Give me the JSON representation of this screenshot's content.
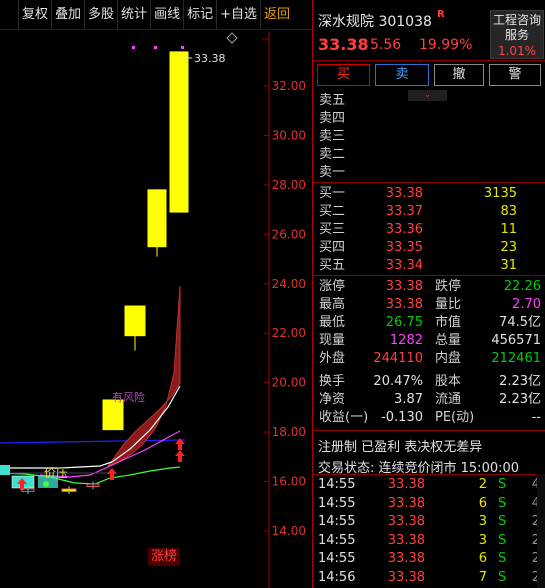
{
  "toolbar": {
    "items": [
      "复权",
      "叠加",
      "多股",
      "统计",
      "画线",
      "标记",
      "+自选",
      "返回"
    ]
  },
  "chart": {
    "annotations": {
      "high_label": "33.38",
      "risk_label": "有风险",
      "pressure_label": "价压",
      "limit_up_tag": "涨榜"
    },
    "y_ticks": [
      "32.00",
      "30.00",
      "28.00",
      "26.00",
      "24.00",
      "22.00",
      "20.00",
      "18.00",
      "16.00",
      "14.00"
    ],
    "colors": {
      "up": "#ffff00",
      "down": "#00ffff",
      "ma_white": "#ffffff",
      "ma_magenta": "#ff40ff",
      "ma_green": "#40ff40",
      "ma_blue": "#2020ff",
      "cloud": "#8b1a1a",
      "axis_text": "#e03030",
      "signal_arrow": "#ff2020"
    }
  },
  "chart_data": {
    "type": "candlestick",
    "y_axis_ticks": [
      32,
      30,
      28,
      26,
      24,
      22,
      20,
      18,
      16,
      14
    ],
    "candles": [
      {
        "open": 15.7,
        "close": 15.6,
        "high": 15.8,
        "low": 15.5
      },
      {
        "open": 15.6,
        "close": 15.7,
        "high": 15.8,
        "low": 15.5
      },
      {
        "open": 15.9,
        "close": 15.8,
        "high": 16.0,
        "low": 15.7
      },
      {
        "open": 18.1,
        "close": 19.3,
        "high": 19.3,
        "low": 18.1
      },
      {
        "open": 21.9,
        "close": 23.1,
        "high": 23.1,
        "low": 21.3
      },
      {
        "open": 25.5,
        "close": 27.8,
        "high": 27.8,
        "low": 25.1
      },
      {
        "open": 26.9,
        "close": 33.38,
        "high": 33.38,
        "low": 26.9
      }
    ]
  },
  "quote": {
    "name_code": "深水规院 301038",
    "r_badge": "R",
    "price": "33.38",
    "change": "5.56",
    "change_pct": "19.99%",
    "sector": {
      "line1": "工程咨询",
      "line2": "服务",
      "pct": "1.01%"
    },
    "buttons": {
      "buy": "买",
      "sell": "卖",
      "cancel": "撤",
      "alert": "警"
    },
    "expand_arrow": "⌄",
    "sell_levels": [
      {
        "label": "卖五"
      },
      {
        "label": "卖四"
      },
      {
        "label": "卖三"
      },
      {
        "label": "卖二"
      },
      {
        "label": "卖一"
      }
    ],
    "buy_levels": [
      {
        "label": "买一",
        "price": "33.38",
        "vol": "3135"
      },
      {
        "label": "买二",
        "price": "33.37",
        "vol": "83"
      },
      {
        "label": "买三",
        "price": "33.36",
        "vol": "11"
      },
      {
        "label": "买四",
        "price": "33.35",
        "vol": "23"
      },
      {
        "label": "买五",
        "price": "33.34",
        "vol": "31"
      }
    ],
    "stats": [
      {
        "l1": "涨停",
        "v1": "33.38",
        "c1": "#ff4040",
        "l2": "跌停",
        "v2": "22.26",
        "c2": "#00d000"
      },
      {
        "l1": "最高",
        "v1": "33.38",
        "c1": "#ff4040",
        "l2": "量比",
        "v2": "2.70",
        "c2": "#ff40ff"
      },
      {
        "l1": "最低",
        "v1": "26.75",
        "c1": "#00d000",
        "l2": "市值",
        "v2": "74.5亿",
        "c2": "#e0e0e0"
      },
      {
        "l1": "现量",
        "v1": "1282",
        "c1": "#ff40ff",
        "l2": "总量",
        "v2": "456571",
        "c2": "#e0e0e0"
      },
      {
        "l1": "外盘",
        "v1": "244110",
        "c1": "#ff4040",
        "l2": "内盘",
        "v2": "212461",
        "c2": "#00d000"
      },
      {
        "l1": "换手",
        "v1": "20.47%",
        "c1": "#e0e0e0",
        "l2": "股本",
        "v2": "2.23亿",
        "c2": "#e0e0e0"
      },
      {
        "l1": "净资",
        "v1": "3.87",
        "c1": "#e0e0e0",
        "l2": "流通",
        "v2": "2.23亿",
        "c2": "#e0e0e0"
      },
      {
        "l1": "收益(一)",
        "v1": "-0.130",
        "c1": "#e0e0e0",
        "l2": "PE(动)",
        "v2": "--",
        "c2": "#e0e0e0"
      }
    ],
    "notice": "注册制 已盈利 表决权无差异",
    "trade_status": "交易状态: 连续竞价闭市 15:00:00",
    "ticks": [
      {
        "time": "14:55",
        "price": "33.38",
        "vol": "2",
        "side": "S",
        "count": "4"
      },
      {
        "time": "14:55",
        "price": "33.38",
        "vol": "6",
        "side": "S",
        "count": "4"
      },
      {
        "time": "14:55",
        "price": "33.38",
        "vol": "3",
        "side": "S",
        "count": "2"
      },
      {
        "time": "14:55",
        "price": "33.38",
        "vol": "3",
        "side": "S",
        "count": "2"
      },
      {
        "time": "14:55",
        "price": "33.38",
        "vol": "6",
        "side": "S",
        "count": "2"
      },
      {
        "time": "14:56",
        "price": "33.38",
        "vol": "7",
        "side": "S",
        "count": "2"
      }
    ]
  }
}
